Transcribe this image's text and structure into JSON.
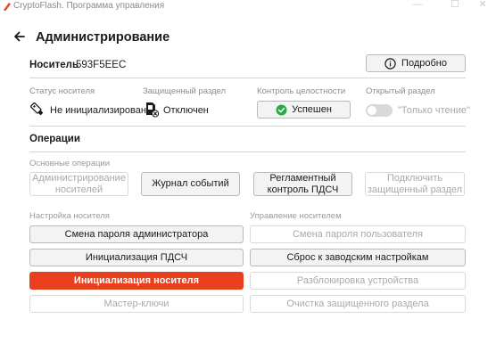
{
  "window": {
    "title": "CryptoFlash. Программа управления",
    "minimize": "—",
    "maximize": "☐",
    "close": "✕"
  },
  "header": {
    "title": "Администрирование"
  },
  "carrier": {
    "label": "Носитель",
    "id": "593F5EEC",
    "details_button": "Подробно"
  },
  "status": {
    "carrier_status_label": "Статус носителя",
    "carrier_status_value": "Не инициализирован",
    "protected_label": "Защищенный раздел",
    "protected_value": "Отключен",
    "integrity_label": "Контроль целостности",
    "integrity_value": "Успешен",
    "open_label": "Открытый раздел",
    "open_value": "\"Только чтение\"",
    "open_toggle_on": false
  },
  "operations": {
    "title": "Операции",
    "basic_label": "Основные операции",
    "basic": [
      {
        "label": "Администрирование носителей",
        "enabled": false
      },
      {
        "label": "Журнал событий",
        "enabled": true
      },
      {
        "label": "Регламентный контроль ПДСЧ",
        "enabled": true
      },
      {
        "label": "Подключить защищенный раздел",
        "enabled": false
      }
    ],
    "setup_label": "Настройка носителя",
    "manage_label": "Управление носителем",
    "setup": [
      {
        "label": "Смена пароля администратора",
        "enabled": true
      },
      {
        "label": "Инициализация ПДСЧ",
        "enabled": true
      },
      {
        "label": "Инициализация носителя",
        "enabled": true
      },
      {
        "label": "Мастер-ключи",
        "enabled": false
      }
    ],
    "manage": [
      {
        "label": "Смена пароля пользователя",
        "enabled": false
      },
      {
        "label": "Сброс к заводским настройкам",
        "enabled": true
      },
      {
        "label": "Разблокировка устройства",
        "enabled": false
      },
      {
        "label": "Очистка защищенного раздела",
        "enabled": false
      }
    ]
  },
  "colors": {
    "accent": "#e8401c",
    "success": "#2aa84a"
  }
}
